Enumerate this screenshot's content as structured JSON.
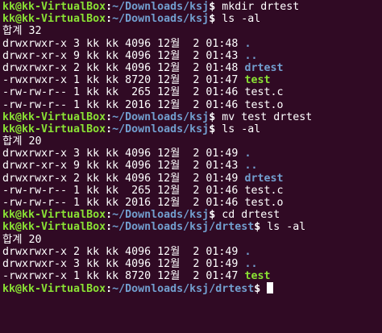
{
  "theme": {
    "background": "#300a24",
    "user_color": "#8ae234",
    "path_color": "#729fcf",
    "text_color": "#ffffff",
    "dir_color": "#729fcf",
    "exec_color": "#8ae234"
  },
  "terminal": {
    "lines": [
      {
        "type": "prompt",
        "user": "kk@kk-VirtualBox",
        "path": "~/Downloads/ksj",
        "cmd": "mkdir drtest"
      },
      {
        "type": "prompt",
        "user": "kk@kk-VirtualBox",
        "path": "~/Downloads/ksj",
        "cmd": "ls -al"
      },
      {
        "type": "total",
        "text": "합계 32"
      },
      {
        "type": "entry",
        "perm": "drwxrwxr-x 3 kk kk 4096 12월  2 01:48 ",
        "name": ".",
        "kind": "dir"
      },
      {
        "type": "entry",
        "perm": "drwxr-xr-x 9 kk kk 4096 12월  2 01:43 ",
        "name": "..",
        "kind": "dir"
      },
      {
        "type": "entry",
        "perm": "drwxrwxr-x 2 kk kk 4096 12월  2 01:48 ",
        "name": "drtest",
        "kind": "dir"
      },
      {
        "type": "entry",
        "perm": "-rwxrwxr-x 1 kk kk 8720 12월  2 01:47 ",
        "name": "test",
        "kind": "exe"
      },
      {
        "type": "entry",
        "perm": "-rw-rw-r-- 1 kk kk  265 12월  2 01:46 ",
        "name": "test.c",
        "kind": "file"
      },
      {
        "type": "entry",
        "perm": "-rw-rw-r-- 1 kk kk 2016 12월  2 01:46 ",
        "name": "test.o",
        "kind": "file"
      },
      {
        "type": "prompt",
        "user": "kk@kk-VirtualBox",
        "path": "~/Downloads/ksj",
        "cmd": "mv test drtest"
      },
      {
        "type": "prompt",
        "user": "kk@kk-VirtualBox",
        "path": "~/Downloads/ksj",
        "cmd": "ls -al"
      },
      {
        "type": "total",
        "text": "합계 20"
      },
      {
        "type": "entry",
        "perm": "drwxrwxr-x 3 kk kk 4096 12월  2 01:49 ",
        "name": ".",
        "kind": "dir"
      },
      {
        "type": "entry",
        "perm": "drwxr-xr-x 9 kk kk 4096 12월  2 01:43 ",
        "name": "..",
        "kind": "dir"
      },
      {
        "type": "entry",
        "perm": "drwxrwxr-x 2 kk kk 4096 12월  2 01:49 ",
        "name": "drtest",
        "kind": "dir"
      },
      {
        "type": "entry",
        "perm": "-rw-rw-r-- 1 kk kk  265 12월  2 01:46 ",
        "name": "test.c",
        "kind": "file"
      },
      {
        "type": "entry",
        "perm": "-rw-rw-r-- 1 kk kk 2016 12월  2 01:46 ",
        "name": "test.o",
        "kind": "file"
      },
      {
        "type": "prompt",
        "user": "kk@kk-VirtualBox",
        "path": "~/Downloads/ksj",
        "cmd": "cd drtest"
      },
      {
        "type": "prompt",
        "user": "kk@kk-VirtualBox",
        "path": "~/Downloads/ksj/drtest",
        "cmd": "ls -al"
      },
      {
        "type": "total",
        "text": "합계 20"
      },
      {
        "type": "entry",
        "perm": "drwxrwxr-x 2 kk kk 4096 12월  2 01:49 ",
        "name": ".",
        "kind": "dir"
      },
      {
        "type": "entry",
        "perm": "drwxrwxr-x 3 kk kk 4096 12월  2 01:49 ",
        "name": "..",
        "kind": "dir"
      },
      {
        "type": "entry",
        "perm": "-rwxrwxr-x 1 kk kk 8720 12월  2 01:47 ",
        "name": "test",
        "kind": "exe"
      },
      {
        "type": "prompt",
        "user": "kk@kk-VirtualBox",
        "path": "~/Downloads/ksj/drtest",
        "cmd": "",
        "cursor": true
      }
    ]
  }
}
